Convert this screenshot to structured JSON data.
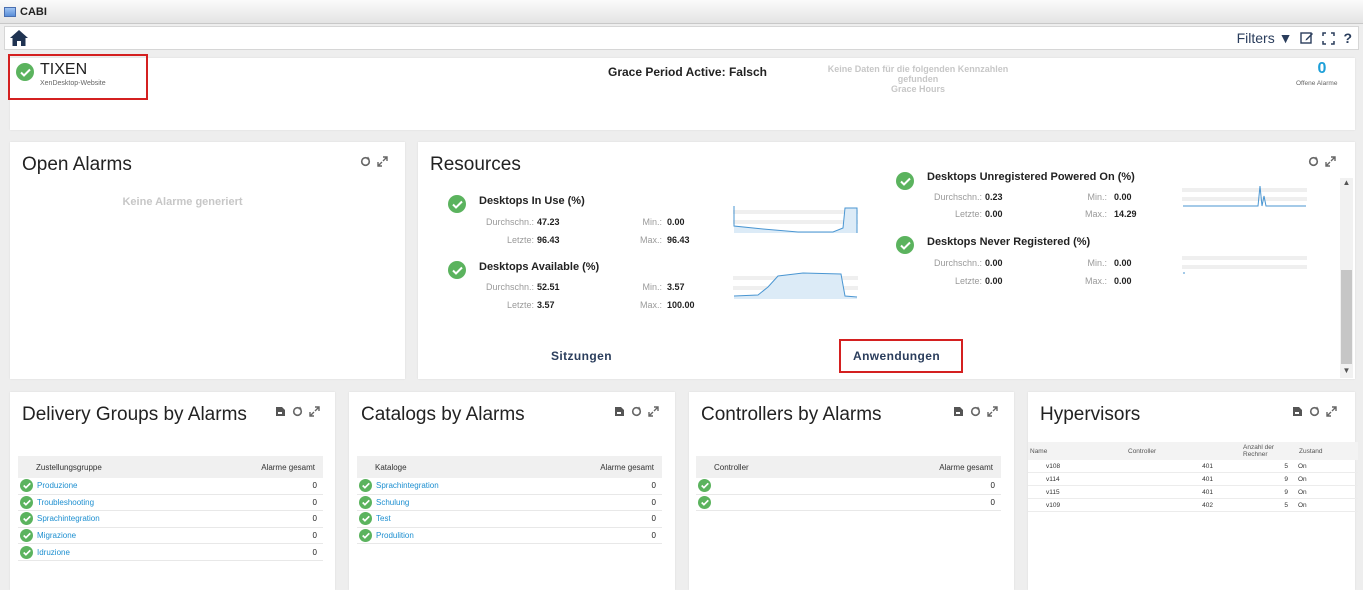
{
  "window": {
    "title": "CABI"
  },
  "toolbar": {
    "filters_label": "Filters ▼",
    "help_label": "?"
  },
  "header": {
    "site_name": "TIXEN",
    "site_subtitle": "XenDesktop-Website",
    "grace_period": "Grace Period Active: Falsch",
    "no_data_line1": "Keine Daten für die folgenden Kennzahlen",
    "no_data_line2": "gefunden",
    "no_data_line3": "Grace Hours",
    "open_alarms_count": "0",
    "open_alarms_label": "Offene Alarme"
  },
  "open_alarms": {
    "title": "Open Alarms",
    "empty_text": "Keine Alarme generiert"
  },
  "resources": {
    "title": "Resources",
    "link_sessions": "Sitzungen",
    "link_apps": "Anwendungen",
    "label_avg": "Durchschn.:",
    "label_last": "Letzte:",
    "label_min": "Min.:",
    "label_max": "Max.:",
    "metrics": [
      {
        "name": "Desktops In Use (%)",
        "avg": "47.23",
        "last": "96.43",
        "min": "0.00",
        "max": "96.43"
      },
      {
        "name": "Desktops Available (%)",
        "avg": "52.51",
        "last": "3.57",
        "min": "3.57",
        "max": "100.00"
      },
      {
        "name": "Desktops Unregistered Powered On (%)",
        "avg": "0.23",
        "last": "0.00",
        "min": "0.00",
        "max": "14.29"
      },
      {
        "name": "Desktops Never Registered (%)",
        "avg": "0.00",
        "last": "0.00",
        "min": "0.00",
        "max": "0.00"
      }
    ]
  },
  "delivery_groups": {
    "title": "Delivery Groups by Alarms",
    "col_name": "Zustellungsgruppe",
    "col_total": "Alarme gesamt",
    "rows": [
      {
        "name": "Produzione",
        "count": "0"
      },
      {
        "name": "Troubleshooting",
        "count": "0"
      },
      {
        "name": "Sprachintegration",
        "count": "0"
      },
      {
        "name": "Migrazione",
        "count": "0"
      },
      {
        "name": "Idruzione",
        "count": "0"
      }
    ]
  },
  "catalogs": {
    "title": "Catalogs by Alarms",
    "col_name": "Kataloge",
    "col_total": "Alarme gesamt",
    "rows": [
      {
        "name": "Sprachintegration",
        "count": "0"
      },
      {
        "name": "Schulung",
        "count": "0"
      },
      {
        "name": "Test",
        "count": "0"
      },
      {
        "name": "Produlition",
        "count": "0"
      }
    ]
  },
  "controllers": {
    "title": "Controllers by Alarms",
    "col_name": "Controller",
    "col_total": "Alarme gesamt",
    "rows": [
      {
        "name": "",
        "count": "0"
      },
      {
        "name": "",
        "count": "0"
      }
    ]
  },
  "hypervisors": {
    "title": "Hypervisors",
    "col_name": "Name",
    "col_controller": "Controller",
    "col_machines": "Anzahl der Rechner",
    "col_state": "Zustand",
    "rows": [
      {
        "name": "v108",
        "controller": "401",
        "machines": "5",
        "state": "On"
      },
      {
        "name": "v114",
        "controller": "401",
        "machines": "9",
        "state": "On"
      },
      {
        "name": "v115",
        "controller": "401",
        "machines": "9",
        "state": "On"
      },
      {
        "name": "v109",
        "controller": "402",
        "machines": "5",
        "state": "On"
      }
    ]
  },
  "colors": {
    "accent_link": "#1d8fd0",
    "ok_green": "#5bb35e",
    "highlight_red": "#d42020",
    "nav_dark": "#2a3d5c"
  }
}
